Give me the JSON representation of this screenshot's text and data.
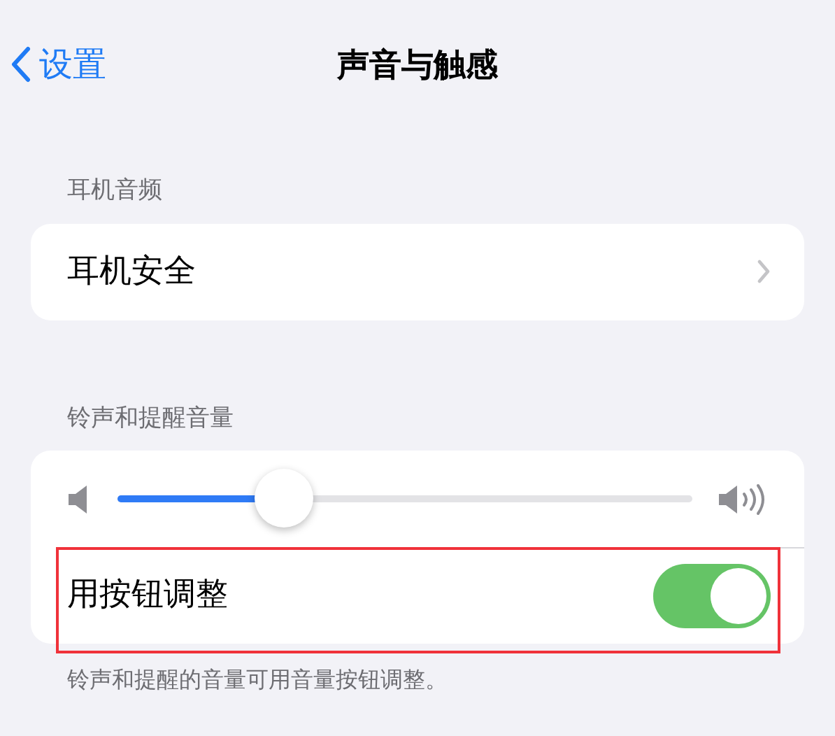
{
  "nav": {
    "back": "设置",
    "title": "声音与触感"
  },
  "sections": [
    {
      "header": "耳机音频",
      "rows": [
        {
          "kind": "link",
          "label": "耳机安全"
        }
      ]
    },
    {
      "header": "铃声和提醒音量",
      "rows": [
        {
          "kind": "slider",
          "level": 0.29
        },
        {
          "kind": "toggle",
          "label": "用按钮调整",
          "on": true,
          "highlighted": true
        }
      ],
      "footer": "铃声和提醒的音量可用音量按钮调整。"
    }
  ]
}
